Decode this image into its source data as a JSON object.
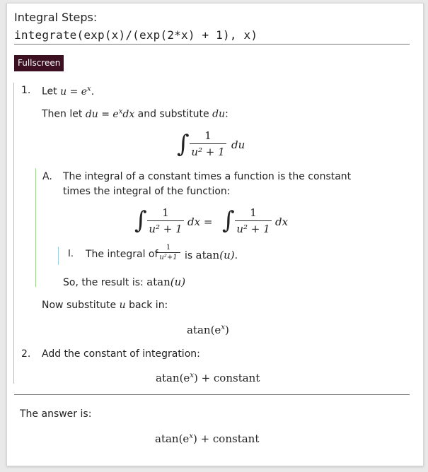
{
  "header": {
    "title": "Integral Steps:",
    "query": "integrate(exp(x)/(exp(2*x) + 1), x)",
    "fullscreen_label": "Fullscreen"
  },
  "steps": {
    "step1": {
      "num": "1.",
      "let_prefix": "Let",
      "let_math": "u = e",
      "let_math_sup": "x",
      "then_prefix": "Then let",
      "then_math": "du = e",
      "then_math_sup": "x",
      "then_math_tail": "dx",
      "then_mid": "and substitute",
      "then_math2": "du",
      "then_colon": ":",
      "integral": {
        "numerator": "1",
        "denominator": "u² + 1",
        "diff": "du"
      },
      "sub": {
        "letter": "A.",
        "text_line1": "The integral of a constant times a function is the constant",
        "text_line2": "times the integral of the function:",
        "eq_left_num": "1",
        "eq_left_den": "u² + 1",
        "eq_left_diff": "dx =",
        "eq_right_num": "1",
        "eq_right_den": "u² + 1",
        "eq_right_diff": "dx",
        "subsub": {
          "roman": "I.",
          "text_prefix": "The integral of",
          "frac_num": "1",
          "frac_den": "u²+1",
          "text_mid": "is",
          "result_fn": "atan",
          "result_arg": "(u)",
          "result_end": "."
        },
        "result_prefix": "So, the result is:",
        "result_fn": "atan",
        "result_arg": "(u)"
      },
      "back_sub_text": "Now substitute",
      "back_sub_var": "u",
      "back_sub_tail": "back in:",
      "back_result_fn": "atan",
      "back_result_arg": "(e",
      "back_result_sup": "x",
      "back_result_close": ")"
    },
    "step2": {
      "num": "2.",
      "text": "Add the constant of integration:",
      "result_fn": "atan",
      "result_arg": "(e",
      "result_sup": "x",
      "result_close": ") + constant"
    }
  },
  "answer": {
    "label": "The answer is:",
    "result_fn": "atan",
    "result_arg": "(e",
    "result_sup": "x",
    "result_close": ") + constant"
  }
}
